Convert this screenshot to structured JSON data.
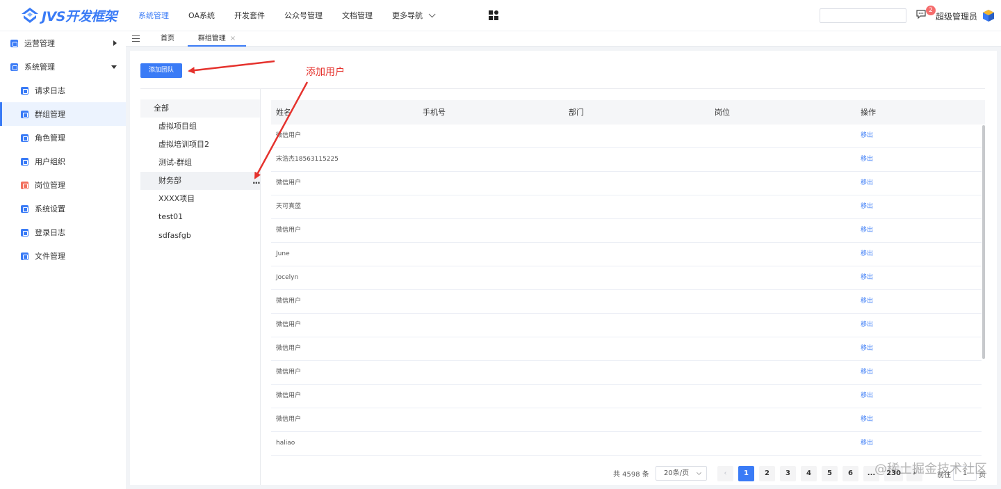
{
  "header": {
    "logo_text": "JVS开发框架",
    "nav": [
      {
        "label": "系统管理",
        "active": true
      },
      {
        "label": "OA系统"
      },
      {
        "label": "开发套件"
      },
      {
        "label": "公众号管理"
      },
      {
        "label": "文档管理"
      },
      {
        "label": "更多导航"
      }
    ],
    "search_value": "",
    "message_count": "2",
    "user_name": "超级管理员"
  },
  "sidebar": {
    "items": [
      {
        "label": "运营管理",
        "level": 1,
        "caret": "right",
        "icon": "ops-icon",
        "color": "#3a7bf6"
      },
      {
        "label": "系统管理",
        "level": 1,
        "caret": "down",
        "icon": "system-icon",
        "color": "#3a7bf6"
      },
      {
        "label": "请求日志",
        "level": 2,
        "icon": "request-log-icon",
        "color": "#3a7bf6"
      },
      {
        "label": "群组管理",
        "level": 2,
        "active": true,
        "icon": "group-icon",
        "color": "#3a7bf6"
      },
      {
        "label": "角色管理",
        "level": 2,
        "icon": "role-icon",
        "color": "#3a7bf6"
      },
      {
        "label": "用户组织",
        "level": 2,
        "icon": "org-icon",
        "color": "#3a7bf6"
      },
      {
        "label": "岗位管理",
        "level": 2,
        "icon": "post-icon",
        "color": "#f2705e"
      },
      {
        "label": "系统设置",
        "level": 2,
        "icon": "settings-icon",
        "color": "#3a7bf6"
      },
      {
        "label": "登录日志",
        "level": 2,
        "icon": "login-log-icon",
        "color": "#3a7bf6"
      },
      {
        "label": "文件管理",
        "level": 2,
        "icon": "file-icon",
        "color": "#3a7bf6"
      }
    ]
  },
  "tabs": [
    {
      "label": "首页"
    },
    {
      "label": "群组管理",
      "active": true,
      "close": "×"
    }
  ],
  "toolbar": {
    "add_team_label": "添加团队"
  },
  "annotation": {
    "label": "添加用户",
    "color": "#e5322d"
  },
  "groups": {
    "all_label": "全部",
    "items": [
      "虚拟项目组",
      "虚拟培训项目2",
      "测试-群组",
      "财务部",
      "XXXX项目",
      "test01",
      "sdfasfgb"
    ],
    "hovered_index": 3,
    "more": "···"
  },
  "table": {
    "columns": [
      "姓名",
      "手机号",
      "部门",
      "岗位",
      "操作"
    ],
    "rows": [
      {
        "name": "微信用户",
        "action": "移出"
      },
      {
        "name": "宋浩杰18563115225",
        "action": "移出"
      },
      {
        "name": "微信用户",
        "action": "移出"
      },
      {
        "name": "天可真蓝",
        "action": "移出"
      },
      {
        "name": "微信用户",
        "action": "移出"
      },
      {
        "name": "June",
        "action": "移出"
      },
      {
        "name": "Jocelyn",
        "action": "移出"
      },
      {
        "name": "微信用户",
        "action": "移出"
      },
      {
        "name": "微信用户",
        "action": "移出"
      },
      {
        "name": "微信用户",
        "action": "移出"
      },
      {
        "name": "微信用户",
        "action": "移出"
      },
      {
        "name": "微信用户",
        "action": "移出"
      },
      {
        "name": "微信用户",
        "action": "移出"
      },
      {
        "name": "haliao",
        "action": "移出"
      }
    ]
  },
  "pagination": {
    "total": "共 4598 条",
    "page_size": "20条/页",
    "prev": "‹",
    "pages": [
      "1",
      "2",
      "3",
      "4",
      "5",
      "6",
      "...",
      "230"
    ],
    "current": "1",
    "next": "›",
    "goto_label": "前往",
    "goto_value": "1",
    "goto_unit": "页"
  },
  "watermark": "@稀土掘金技术社区",
  "colors": {
    "accent": "#3a7bf6",
    "annotation": "#e5322d",
    "badge": "#f56c6c"
  }
}
